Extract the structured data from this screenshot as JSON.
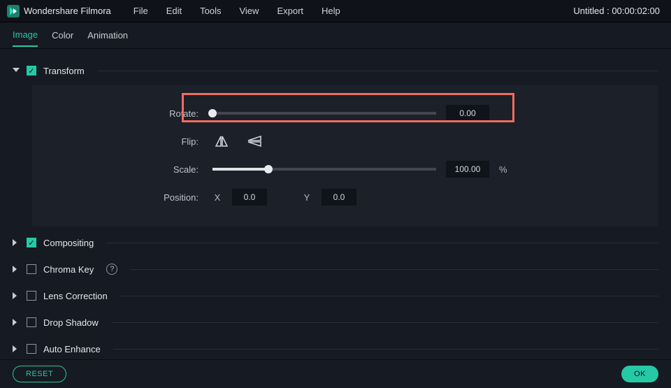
{
  "app": {
    "title": "Wondershare Filmora"
  },
  "menu": [
    "File",
    "Edit",
    "Tools",
    "View",
    "Export",
    "Help"
  ],
  "project_info": "Untitled : 00:00:02:00",
  "tabs": {
    "image": "Image",
    "color": "Color",
    "animation": "Animation"
  },
  "sections": {
    "transform": {
      "label": "Transform",
      "checked": true,
      "expanded": true
    },
    "compositing": {
      "label": "Compositing",
      "checked": true,
      "expanded": false
    },
    "chroma": {
      "label": "Chroma Key",
      "checked": false,
      "expanded": false,
      "hint": true
    },
    "lens": {
      "label": "Lens Correction",
      "checked": false,
      "expanded": false
    },
    "drop": {
      "label": "Drop Shadow",
      "checked": false,
      "expanded": false
    },
    "auto": {
      "label": "Auto Enhance",
      "checked": false,
      "expanded": false
    }
  },
  "transform": {
    "rotate_label": "Rotate:",
    "rotate_value": "0.00",
    "flip_label": "Flip:",
    "scale_label": "Scale:",
    "scale_value": "100.00",
    "scale_unit": "%",
    "position_label": "Position:",
    "pos_x_label": "X",
    "pos_x_value": "0.0",
    "pos_y_label": "Y",
    "pos_y_value": "0.0"
  },
  "footer": {
    "reset": "RESET",
    "ok": "OK"
  }
}
